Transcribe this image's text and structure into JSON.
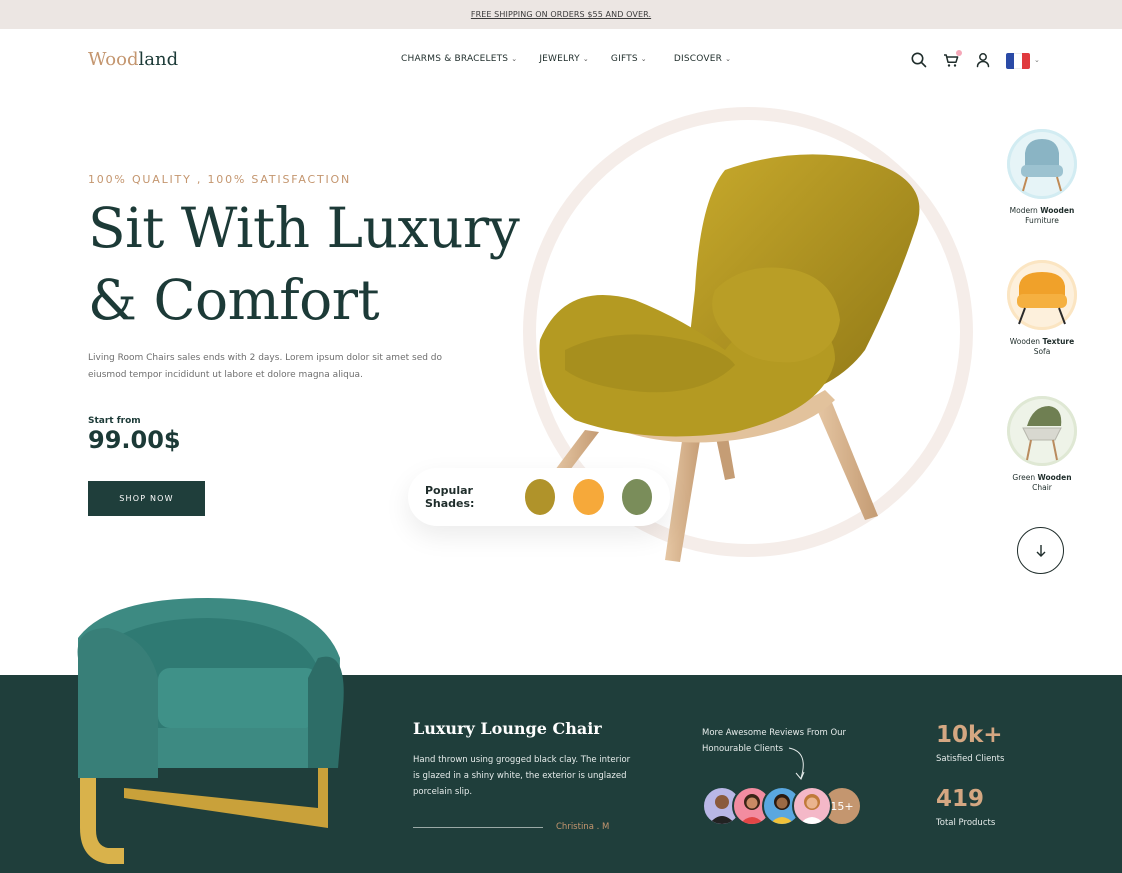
{
  "topbar": {
    "promo": "FREE SHIPPING ON ORDERS $55 AND OVER."
  },
  "header": {
    "logo_accent": "Wood",
    "logo_rest": "land",
    "nav": [
      {
        "label": "CHARMS & BRACELETS"
      },
      {
        "label": "JEWELRY"
      },
      {
        "label": "GIFTS"
      },
      {
        "label": "DISCOVER"
      }
    ],
    "icons": [
      "search-icon",
      "cart-icon",
      "user-icon",
      "flag-france-icon"
    ]
  },
  "hero": {
    "eyebrow": "100% QUALITY , 100% SATISFACTION",
    "headline_line1": "Sit With Luxury",
    "headline_line2": "& Comfort",
    "description": "Living Room Chairs sales ends with 2 days. Lorem ipsum dolor sit amet sed do eiusmod tempor incididunt ut labore et dolore magna aliqua.",
    "start_label": "Start from",
    "price": "99.00$",
    "cta": "SHOP NOW"
  },
  "shades": {
    "label": "Popular Shades:",
    "colors": [
      "#b0932a",
      "#f6a93a",
      "#7a8d5a"
    ]
  },
  "rail": [
    {
      "pre": "Modern ",
      "bold": "Wooden",
      "post": "Furniture"
    },
    {
      "pre": "Wooden ",
      "bold": "Texture",
      "post": "Sofa"
    },
    {
      "pre": "Green ",
      "bold": "Wooden",
      "post": "Chair"
    }
  ],
  "band": {
    "title": "Luxury Lounge Chair",
    "text": "Hand thrown using grogged black clay. The interior is glazed in a shiny white, the exterior is unglazed porcelain slip.",
    "author": "Christina . M",
    "reviews_line1": "More Awesome Reviews From Our",
    "reviews_line2": "Honourable Clients",
    "more_count": "15+",
    "stats": [
      {
        "value": "10k+",
        "label": "Satisfied Clients"
      },
      {
        "value": "419",
        "label": "Total Products"
      }
    ]
  },
  "colors": {
    "primary": "#1f3e3b",
    "accent": "#c4966f",
    "topbar": "#ece6e3"
  }
}
